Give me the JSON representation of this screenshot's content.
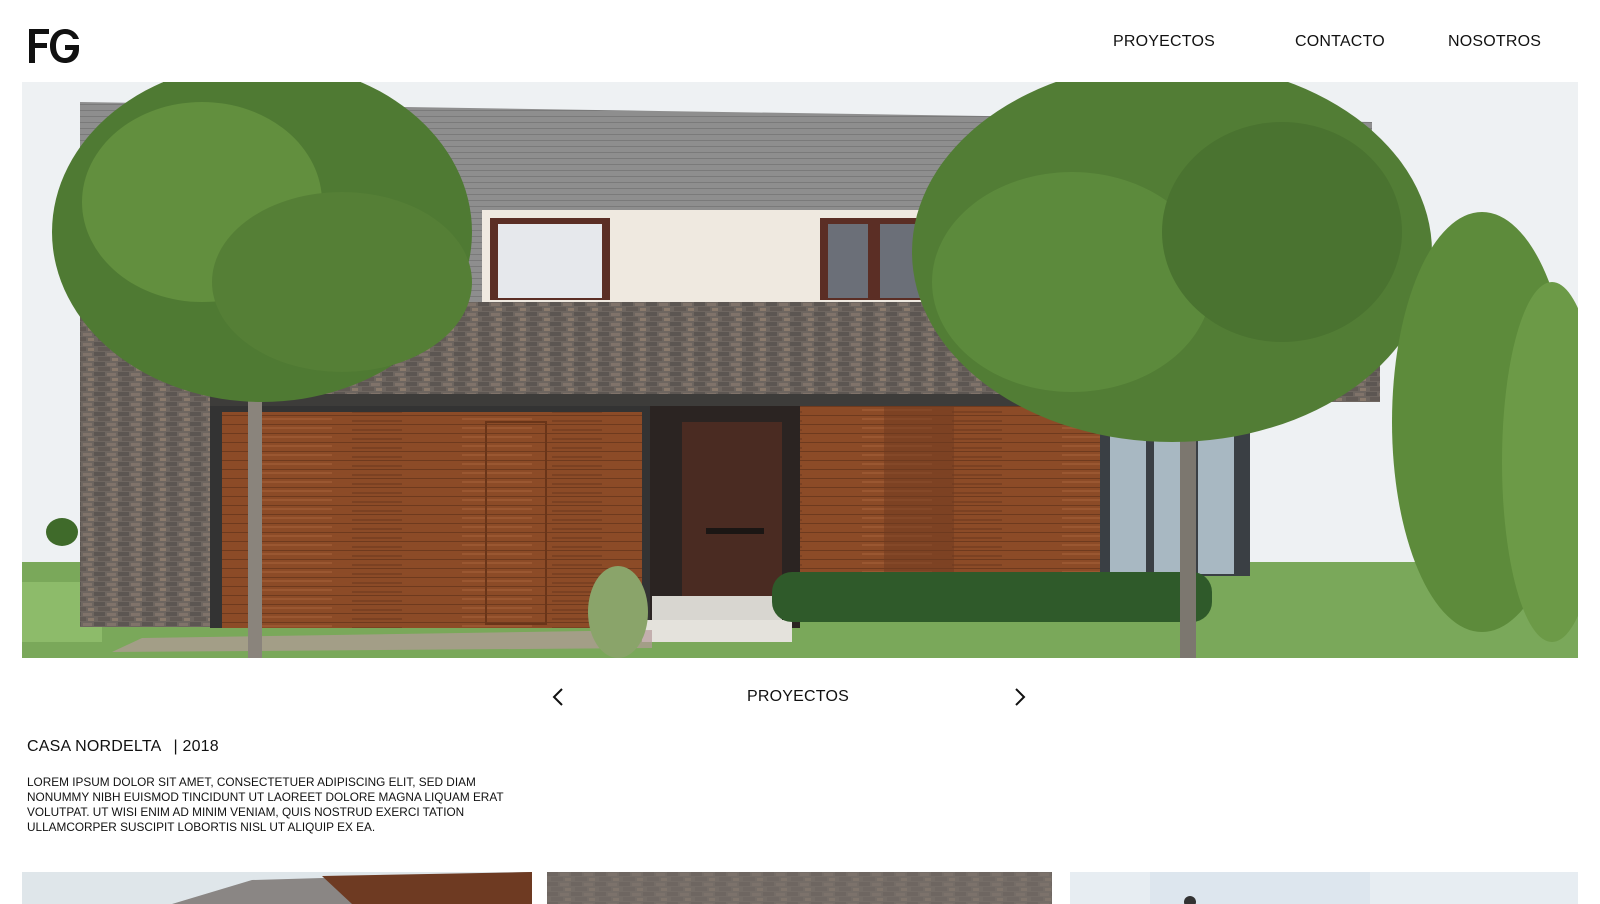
{
  "header": {
    "logo_text": "FG",
    "nav": [
      {
        "label": "PROYECTOS"
      },
      {
        "label": "CONTACTO"
      },
      {
        "label": "NOSOTROS"
      }
    ]
  },
  "carousel": {
    "label": "PROYECTOS",
    "prev_icon": "chevron-left-icon",
    "next_icon": "chevron-right-icon"
  },
  "project": {
    "name": "CASA NORDELTA",
    "year": "| 2018",
    "description": "LOREM IPSUM DOLOR SIT AMET, CONSECTETUER ADIPISCING ELIT, SED  DIAM NONUMMY NIBH EUISMOD TINCIDUNT UT LAOREET DOLORE MAGNA  LIQUAM ERAT VOLUTPAT. UT WISI ENIM AD MINIM VENIAM, QUIS NOSTRUD  EXERCI TATION ULLAMCORPER SUSCIPIT LOBORTIS NISL UT ALIQUIP EX EA."
  },
  "colors": {
    "text": "#111111",
    "background": "#ffffff",
    "wood": "#8a4a26",
    "stone": "#6b6560",
    "cladding": "#8f8f8f",
    "foliage": "#4f7a33"
  }
}
